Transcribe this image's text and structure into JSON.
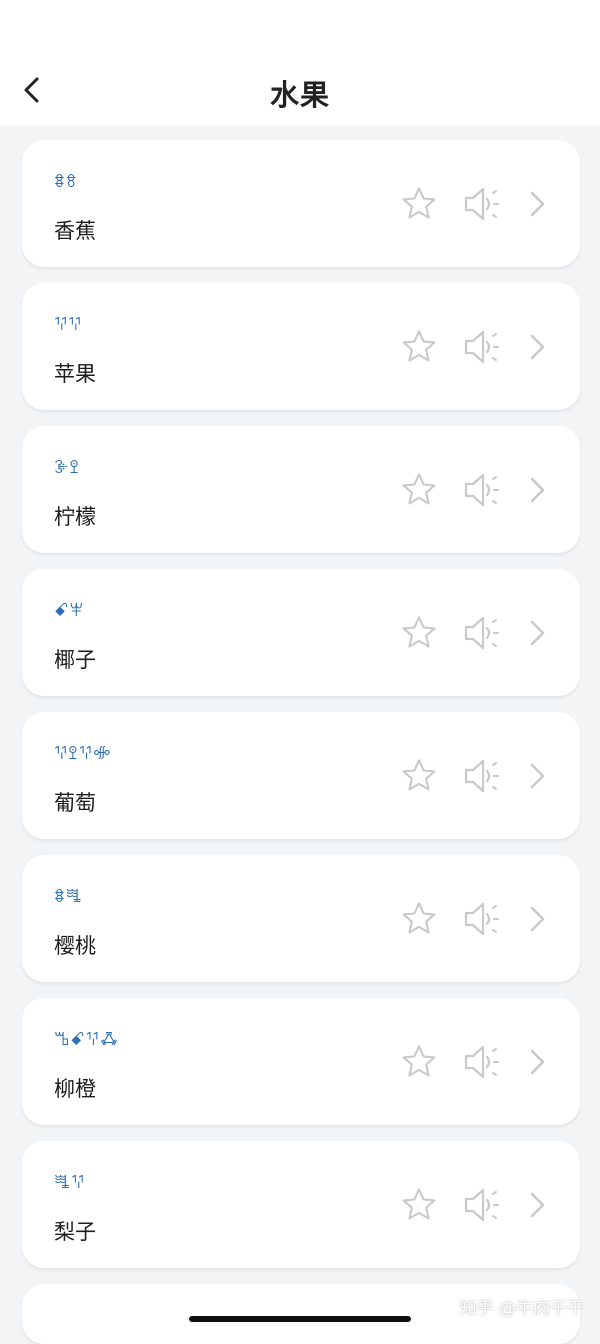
{
  "header": {
    "title": "水果",
    "back_icon": "chevron-left-icon"
  },
  "items": [
    {
      "script": "ꗊꗉ",
      "name": "香蕉"
    },
    {
      "script": "ꖬꖬ",
      "name": "苹果"
    },
    {
      "script": "ꘀꖶ",
      "name": "柠檬"
    },
    {
      "script": "ꗃꕽ",
      "name": "椰子"
    },
    {
      "script": "ꖬꖶꖬꗂ",
      "name": "葡萄"
    },
    {
      "script": "ꗊꗀ",
      "name": "樱桃"
    },
    {
      "script": "ꕰꗃꖬꗈ",
      "name": "柳橙"
    },
    {
      "script": "ꗀꖬ",
      "name": "梨子"
    }
  ],
  "item_icons": {
    "favorite": "star-icon",
    "audio": "speaker-icon",
    "detail": "chevron-right-icon"
  },
  "colors": {
    "script_text": "#2c6db4",
    "icon": "#c9c9c9",
    "background": "#f3f4f6"
  },
  "watermark": "知乎 @牛肉干干"
}
